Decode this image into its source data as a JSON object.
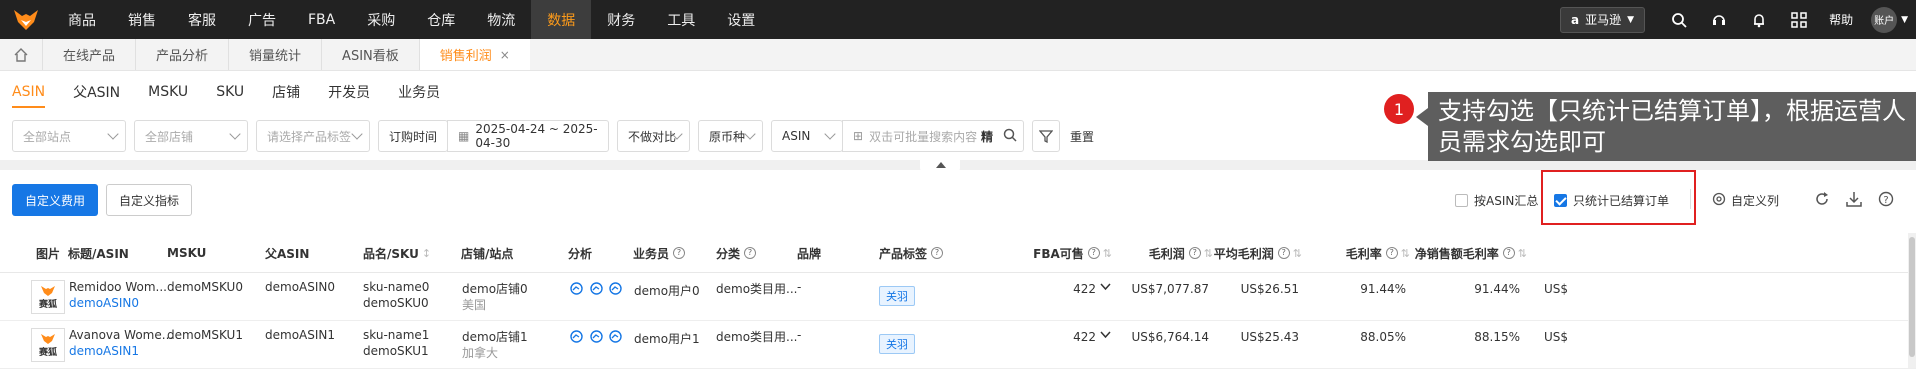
{
  "topnav": {
    "items": [
      "商品",
      "销售",
      "客服",
      "广告",
      "FBA",
      "采购",
      "仓库",
      "物流",
      "数据",
      "财务",
      "工具",
      "设置"
    ],
    "active_index": 8,
    "marketplace": "亚马逊",
    "help": "帮助",
    "account": "账户"
  },
  "pagetabs": [
    {
      "label": "在线产品"
    },
    {
      "label": "产品分析"
    },
    {
      "label": "销量统计"
    },
    {
      "label": "ASIN看板"
    },
    {
      "label": "销售利润",
      "active": true,
      "close": "×"
    }
  ],
  "subtabs": [
    "ASIN",
    "父ASIN",
    "MSKU",
    "SKU",
    "店铺",
    "开发员",
    "业务员"
  ],
  "filters": {
    "site": "全部站点",
    "shop": "全部店铺",
    "tag": "请选择产品标签",
    "time_label": "订购时间",
    "date_range": "2025-04-24 ~ 2025-04-30",
    "compare": "不做对比",
    "currency": "原币种",
    "field": "ASIN",
    "search_placeholder": "双击可批量搜索内容",
    "exact": "精",
    "reset": "重置"
  },
  "actions": {
    "custom_fee": "自定义费用",
    "custom_metric": "自定义指标",
    "asin_summary": "按ASIN汇总",
    "only_settled": "只统计已结算订单",
    "custom_columns": "自定义列"
  },
  "callout": {
    "number": "1",
    "text": "支持勾选【只统计已结算订单】，根据运营人员需求勾选即可"
  },
  "table": {
    "headers": [
      "图片",
      "标题/ASIN",
      "MSKU",
      "父ASIN",
      "品名/SKU",
      "店铺/站点",
      "分析",
      "业务员",
      "分类",
      "品牌",
      "产品标签",
      "FBA可售",
      "毛利润",
      "平均毛利润",
      "毛利率",
      "净销售额毛利率"
    ],
    "rows": [
      {
        "thumb": "赛狐",
        "title": "Remidoo Wom...",
        "asin": "demoASIN0",
        "msku": "demoMSKU0",
        "parent": "demoASIN0",
        "name": "sku-name0",
        "sku": "demoSKU0",
        "shop": "demo店铺0",
        "site": "美国",
        "seller": "demo用户0",
        "category": "demo类目用...",
        "brand": "-",
        "tag": "关羽",
        "fba": "422",
        "gross": "US$7,077.87",
        "avg_gross": "US$26.51",
        "margin": "91.44%",
        "net_margin": "91.44%",
        "extra": "US$"
      },
      {
        "thumb": "赛狐",
        "title": "Avanova Wome...",
        "asin": "demoASIN1",
        "msku": "demoMSKU1",
        "parent": "demoASIN1",
        "name": "sku-name1",
        "sku": "demoSKU1",
        "shop": "demo店铺1",
        "site": "加拿大",
        "seller": "demo用户1",
        "category": "demo类目用...",
        "brand": "-",
        "tag": "关羽",
        "fba": "422",
        "gross": "US$6,764.14",
        "avg_gross": "US$25.43",
        "margin": "88.05%",
        "net_margin": "88.15%",
        "extra": "US$"
      }
    ]
  },
  "colors": {
    "accent": "#ff8c1a",
    "primary": "#1677e5",
    "topbar": "#222222",
    "highlight": "#e02020"
  }
}
